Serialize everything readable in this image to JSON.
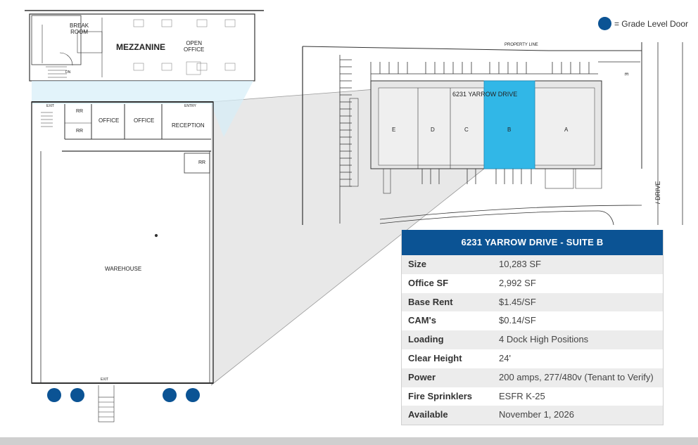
{
  "legend": {
    "text": "= Grade Level Door",
    "color": "#0b5394"
  },
  "floorplan": {
    "mezzanine": "MEZZANINE",
    "break_room": [
      "BREAK",
      "ROOM"
    ],
    "open_office": [
      "OPEN",
      "OFFICE"
    ],
    "dn": "DN",
    "exit_top": "EXIT",
    "entry": "ENTRY",
    "rr1": "RR",
    "rr2": "RR",
    "rr3": "RR",
    "office1": "OFFICE",
    "office2": "OFFICE",
    "reception": "RECEPTION",
    "warehouse": "WAREHOUSE",
    "exit_bottom": "EXIT"
  },
  "siteplan": {
    "property_line": "PROPERTY LINE",
    "address": "6231 YARROW DRIVE",
    "suites": [
      "E",
      "D",
      "C",
      "B",
      "A"
    ],
    "highlight": "B",
    "highlight_color": "#31b7e7",
    "street": "/ DRIVE",
    "small_e": "E"
  },
  "table": {
    "title": "6231 YARROW DRIVE - SUITE B",
    "header_color": "#0b5394",
    "rows": [
      {
        "k": "Size",
        "v": "10,283 SF"
      },
      {
        "k": "Office SF",
        "v": "2,992 SF"
      },
      {
        "k": "Base Rent",
        "v": "$1.45/SF"
      },
      {
        "k": "CAM's",
        "v": "$0.14/SF"
      },
      {
        "k": "Loading",
        "v": "4 Dock High Positions"
      },
      {
        "k": "Clear Height",
        "v": "24'"
      },
      {
        "k": "Power",
        "v": "200 amps, 277/480v (Tenant to Verify)"
      },
      {
        "k": "Fire Sprinklers",
        "v": "ESFR K-25"
      },
      {
        "k": "Available",
        "v": "November 1, 2026"
      }
    ]
  }
}
